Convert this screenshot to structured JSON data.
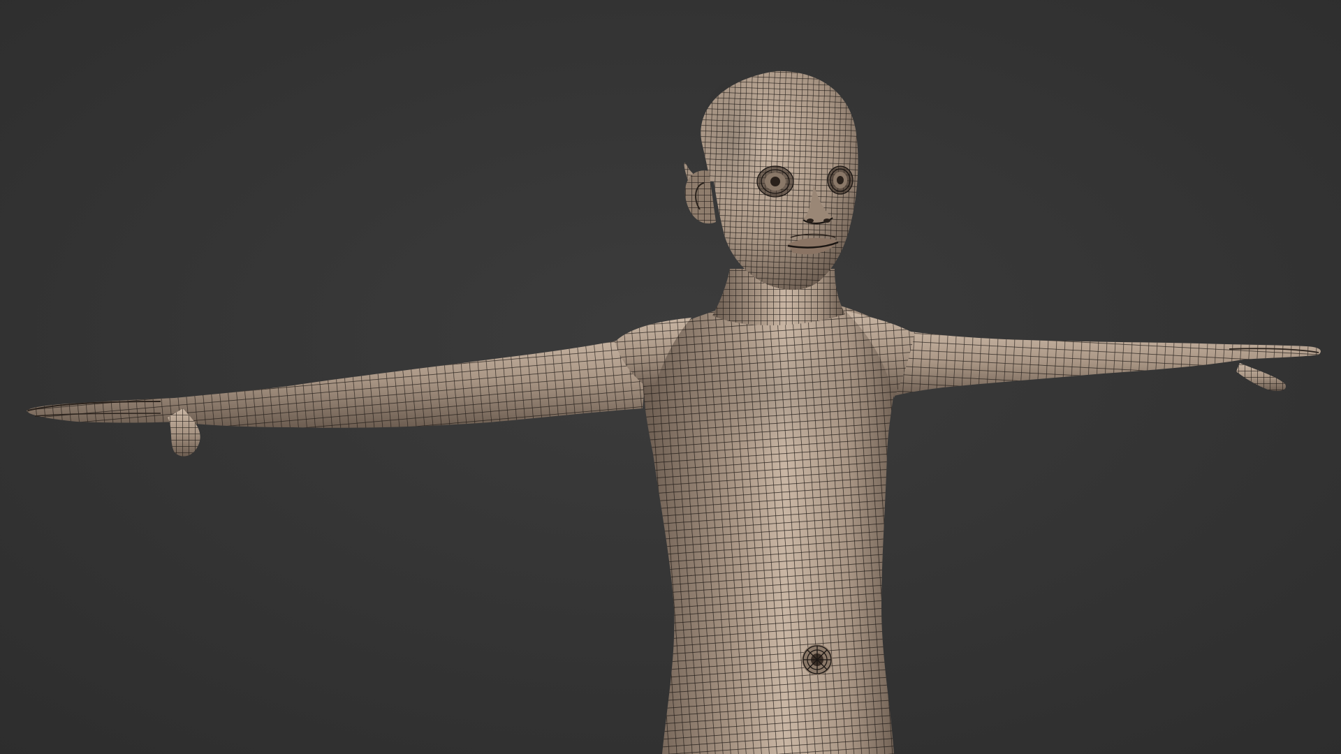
{
  "viewport": {
    "background_color": "#3c3c3c",
    "vignette_color": "#2c2c2c"
  },
  "model": {
    "subject": "child-base-mesh",
    "pose": "t-pose",
    "display_mode": "wireframe-on-shaded",
    "skin_color": "#a89584",
    "skin_highlight_color": "#c9b6a4",
    "skin_shadow_color": "#6c5d51",
    "wire_color": "#1a1512"
  }
}
